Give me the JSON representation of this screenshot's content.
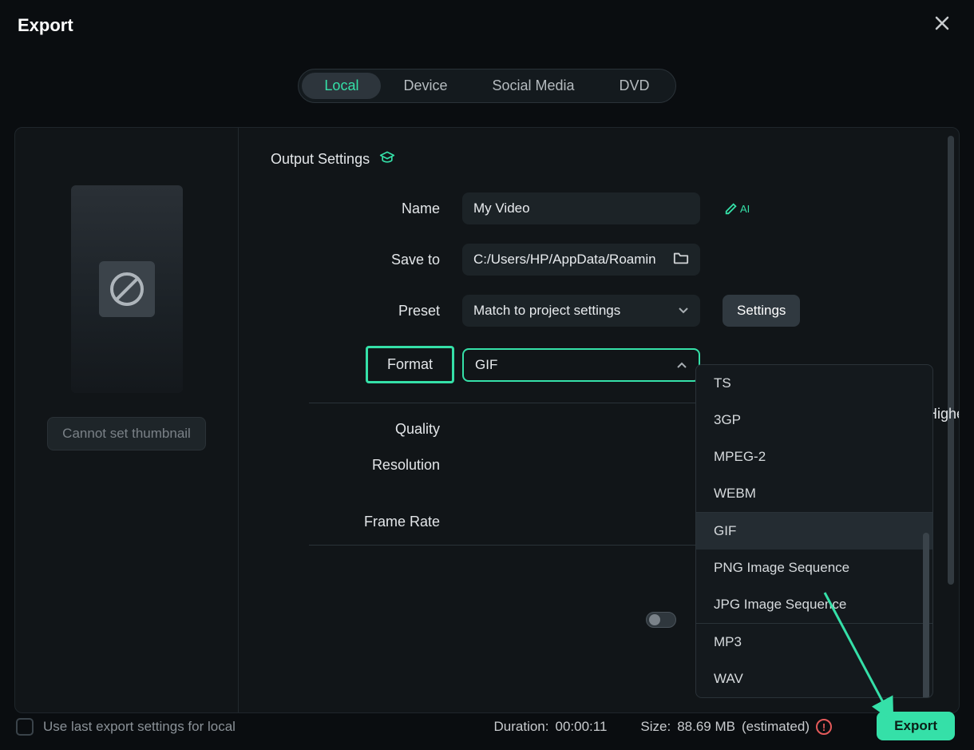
{
  "titlebar": {
    "title": "Export"
  },
  "tabs": {
    "items": [
      "Local",
      "Device",
      "Social Media",
      "DVD"
    ],
    "local": "Local",
    "device": "Device",
    "social": "Social Media",
    "dvd": "DVD"
  },
  "left": {
    "thumbnail_button": "Cannot set thumbnail"
  },
  "output": {
    "heading": "Output Settings",
    "name_label": "Name",
    "name_value": "My Video",
    "ai_tag": "AI",
    "saveto_label": "Save to",
    "saveto_value": "C:/Users/HP/AppData/Roamin",
    "preset_label": "Preset",
    "preset_value": "Match to project settings",
    "settings_button": "Settings",
    "format_label": "Format",
    "format_value": "GIF",
    "quality_label": "Quality",
    "quality_higher": "Higher",
    "resolution_label": "Resolution",
    "framerate_label": "Frame Rate"
  },
  "format_options": [
    "TS",
    "3GP",
    "MPEG-2",
    "WEBM",
    "GIF",
    "PNG Image Sequence",
    "JPG Image Sequence",
    "MP3",
    "WAV"
  ],
  "footer": {
    "use_last": "Use last export settings for local",
    "duration_label": "Duration:",
    "duration_value": "00:00:11",
    "size_label": "Size:",
    "size_value": "88.69 MB",
    "estimated": "(estimated)",
    "export_button": "Export"
  }
}
